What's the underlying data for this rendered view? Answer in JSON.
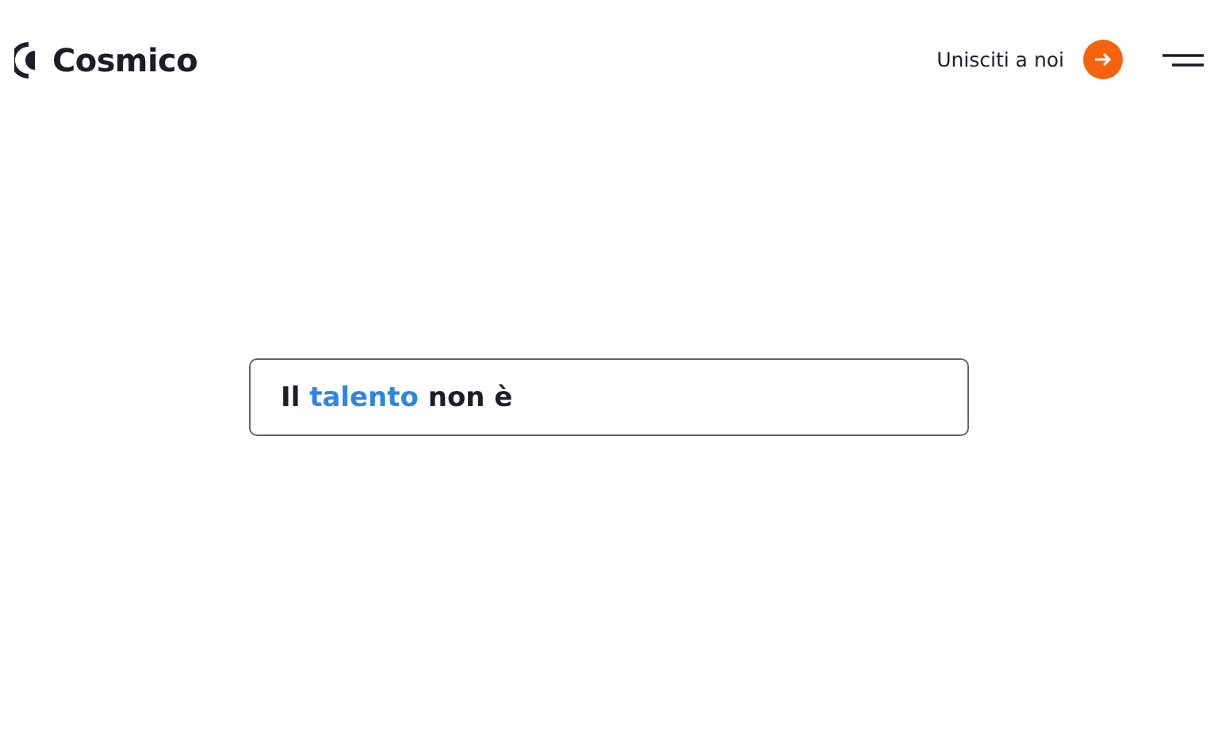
{
  "header": {
    "brand": "Cosmico",
    "join_link": "Unisciti a noi"
  },
  "headline": {
    "segments": [
      {
        "text": "Il",
        "highlighted": false
      },
      {
        "text": "talento",
        "highlighted": true
      },
      {
        "text": "non è",
        "highlighted": false
      }
    ]
  }
}
